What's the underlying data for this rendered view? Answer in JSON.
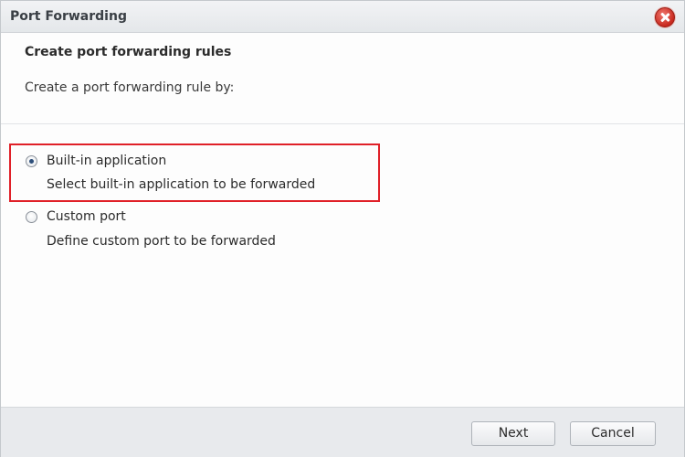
{
  "window": {
    "title": "Port Forwarding",
    "close_icon": "close-icon",
    "close_color": "#d1372c"
  },
  "content": {
    "heading": "Create port forwarding rules",
    "intro": "Create a port forwarding rule by:"
  },
  "options": [
    {
      "label": "Built-in application",
      "description": "Select built-in application to be forwarded",
      "selected": true
    },
    {
      "label": "Custom port",
      "description": "Define custom port to be forwarded",
      "selected": false
    }
  ],
  "highlight_color": "#e02028",
  "buttons": {
    "next": "Next",
    "cancel": "Cancel"
  }
}
